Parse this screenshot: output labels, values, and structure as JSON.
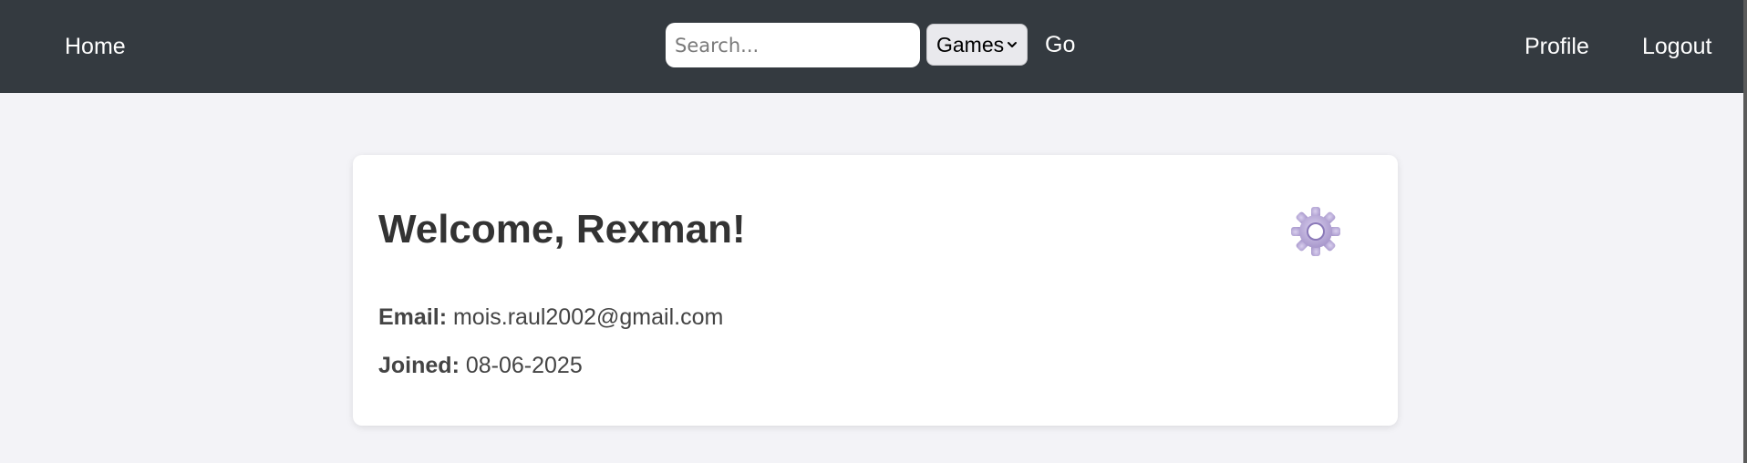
{
  "navbar": {
    "home_label": "Home",
    "search": {
      "placeholder": "Search...",
      "value": ""
    },
    "category_select": {
      "selected": "Games"
    },
    "go_label": "Go",
    "profile_label": "Profile",
    "logout_label": "Logout",
    "background_color": "#343a40"
  },
  "profile_card": {
    "welcome_title": "Welcome, Rexman!",
    "settings_icon": "gear-icon",
    "email_label": "Email:",
    "email_value": "mois.raul2002@gmail.com",
    "joined_label": "Joined:",
    "joined_value": "08-06-2025"
  },
  "colors": {
    "page_background": "#f3f3f7",
    "card_background": "#ffffff",
    "gear_accent": "#b7a8d6"
  }
}
